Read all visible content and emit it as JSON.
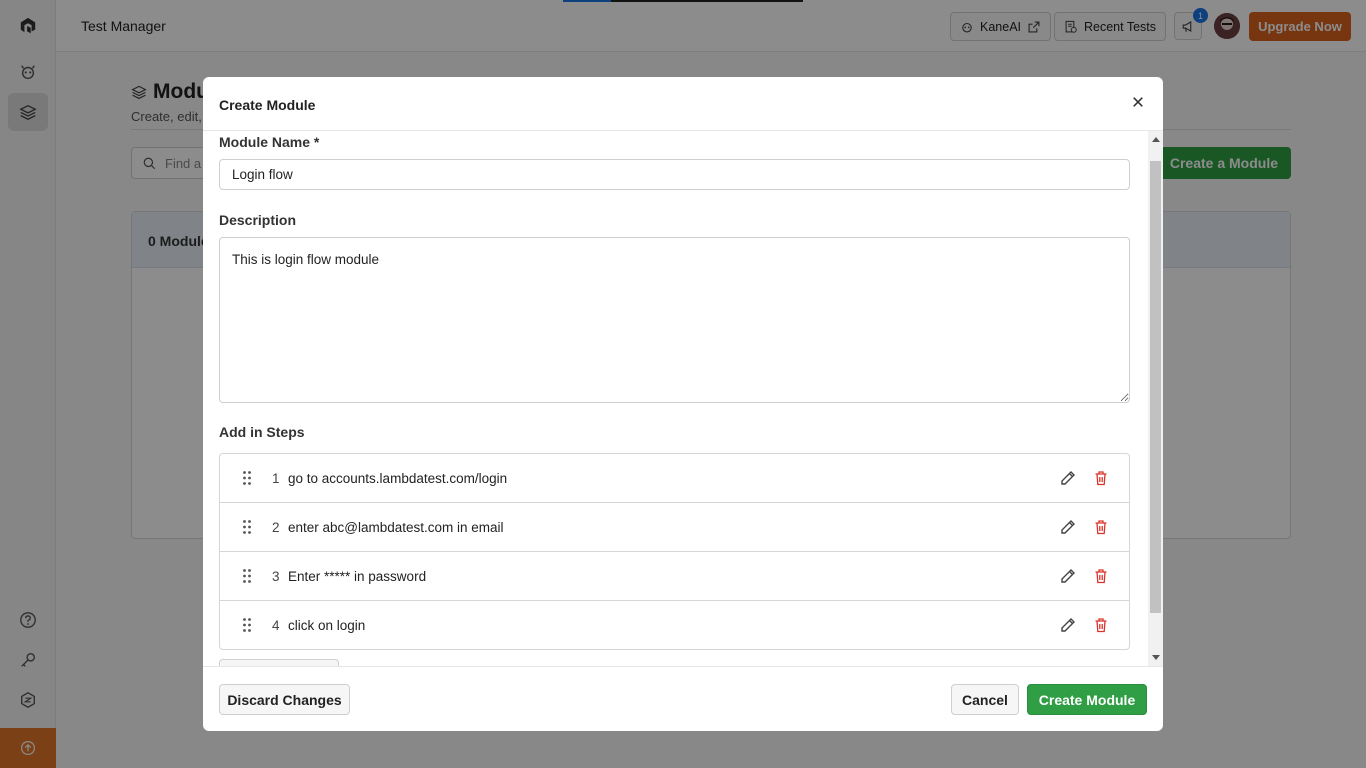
{
  "app": {
    "title": "Test Manager"
  },
  "topbar": {
    "kaneai_label": "KaneAI",
    "recent_tests_label": "Recent Tests",
    "notification_count": "1",
    "upgrade_label": "Upgrade Now"
  },
  "page": {
    "heading": "Modu",
    "subtitle": "Create, edit,",
    "search_placeholder": "Find a",
    "create_button": "Create a Module",
    "table_header": "0 Module"
  },
  "modal": {
    "title": "Create Module",
    "module_name_label": "Module Name *",
    "module_name_value": "Login flow",
    "description_label": "Description",
    "description_value": "This is login flow module",
    "steps_label": "Add in Steps",
    "steps": [
      {
        "num": "1",
        "text": "go to accounts.lambdatest.com/login"
      },
      {
        "num": "2",
        "text": "enter abc@lambdatest.com in email"
      },
      {
        "num": "3",
        "text": "Enter ***** in password"
      },
      {
        "num": "4",
        "text": "click on login"
      }
    ],
    "discard_label": "Discard Changes",
    "cancel_label": "Cancel",
    "create_label": "Create Module"
  },
  "colors": {
    "accent_green": "#2f9e44",
    "upgrade_orange": "#d9631c",
    "delete_red": "#d9342b"
  }
}
